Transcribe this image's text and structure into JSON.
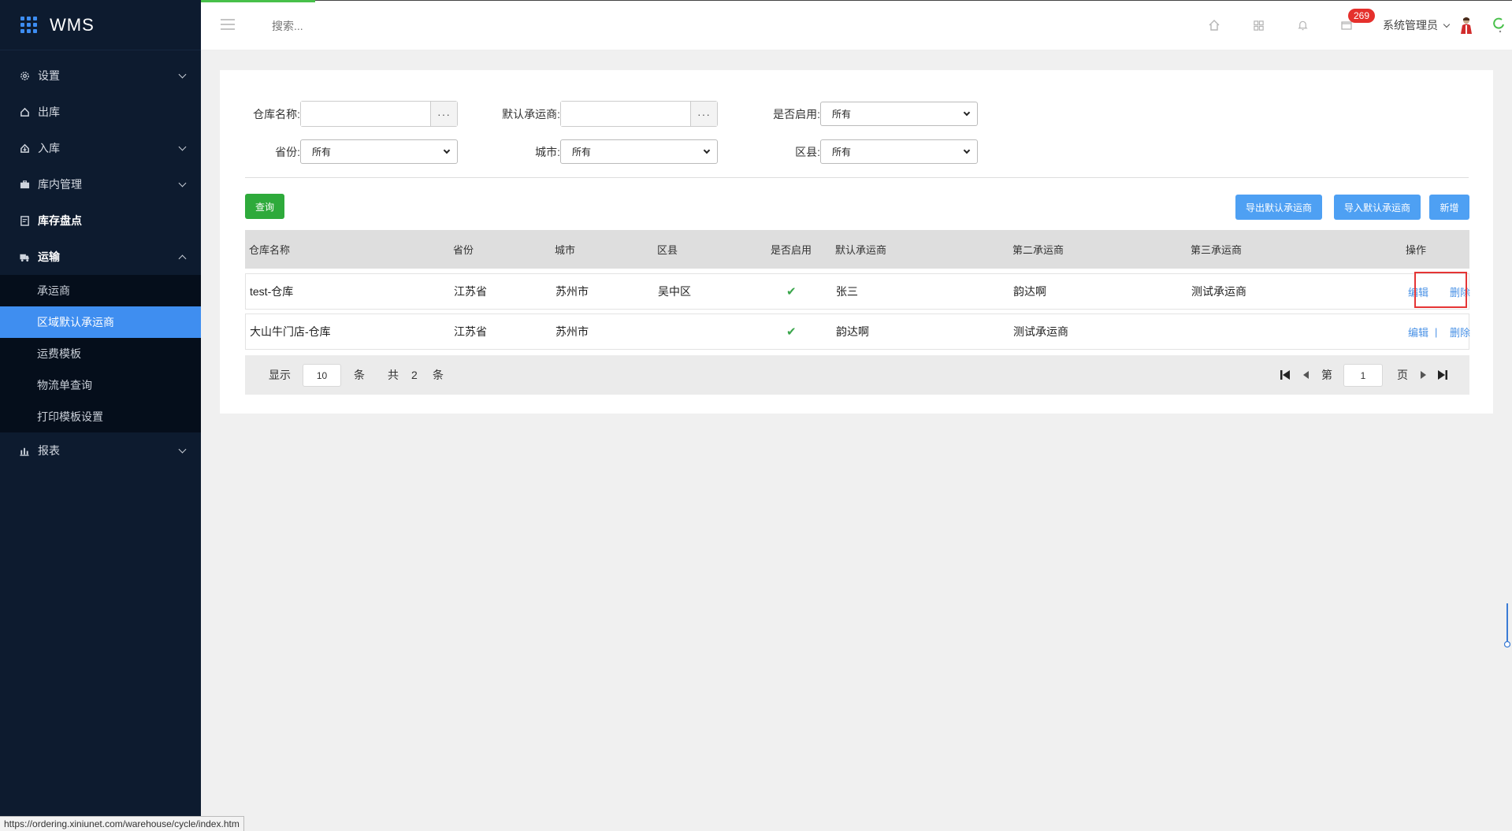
{
  "app": {
    "name": "WMS"
  },
  "sidebar": {
    "items": [
      {
        "label": "设置",
        "icon": "gear-icon",
        "expand": "down"
      },
      {
        "label": "出库",
        "icon": "outbound-icon",
        "expand": ""
      },
      {
        "label": "入库",
        "icon": "inbound-icon",
        "expand": "down"
      },
      {
        "label": "库内管理",
        "icon": "briefcase-icon",
        "expand": "down"
      },
      {
        "label": "库存盘点",
        "icon": "inventory-icon",
        "expand": ""
      },
      {
        "label": "运输",
        "icon": "truck-icon",
        "expand": "up"
      },
      {
        "label": "报表",
        "icon": "bar-chart-icon",
        "expand": "down"
      }
    ],
    "transport_sub": [
      {
        "label": "承运商"
      },
      {
        "label": "区域默认承运商",
        "active": true
      },
      {
        "label": "运费模板"
      },
      {
        "label": "物流单查询"
      },
      {
        "label": "打印模板设置"
      }
    ]
  },
  "header": {
    "search_placeholder": "搜索...",
    "badge_count": "269",
    "user_name": "系统管理员"
  },
  "filters": {
    "warehouse_label": "仓库名称:",
    "carrier_label": "默认承运商:",
    "enabled_label": "是否启用:",
    "enabled_value": "所有",
    "province_label": "省份:",
    "province_value": "所有",
    "city_label": "城市:",
    "city_value": "所有",
    "district_label": "区县:",
    "district_value": "所有"
  },
  "buttons": {
    "query": "查询",
    "export": "导出默认承运商",
    "import": "导入默认承运商",
    "add": "新增"
  },
  "table": {
    "headers": [
      "仓库名称",
      "省份",
      "城市",
      "区县",
      "是否启用",
      "默认承运商",
      "第二承运商",
      "第三承运商",
      "操作"
    ],
    "rows": [
      {
        "warehouse": "test-仓库",
        "province": "江苏省",
        "city": "苏州市",
        "district": "吴中区",
        "enabled": "✔",
        "carrier1": "张三",
        "carrier2": "韵达啊",
        "carrier3": "测试承运商",
        "edit": "编辑",
        "delete": "删除"
      },
      {
        "warehouse": "大山牛门店-仓库",
        "province": "江苏省",
        "city": "苏州市",
        "district": "",
        "enabled": "✔",
        "carrier1": "韵达啊",
        "carrier2": "测试承运商",
        "carrier3": "",
        "edit": "编辑",
        "sep": "|",
        "delete": "删除"
      }
    ]
  },
  "pagination": {
    "show_label": "显示",
    "page_size": "10",
    "unit": "条",
    "total_label": "共",
    "total": "2",
    "total_unit": "条",
    "page_prefix": "第",
    "current_page": "1",
    "page_suffix": "页"
  },
  "status_url": "https://ordering.xiniunet.com/warehouse/cycle/index.htm"
}
